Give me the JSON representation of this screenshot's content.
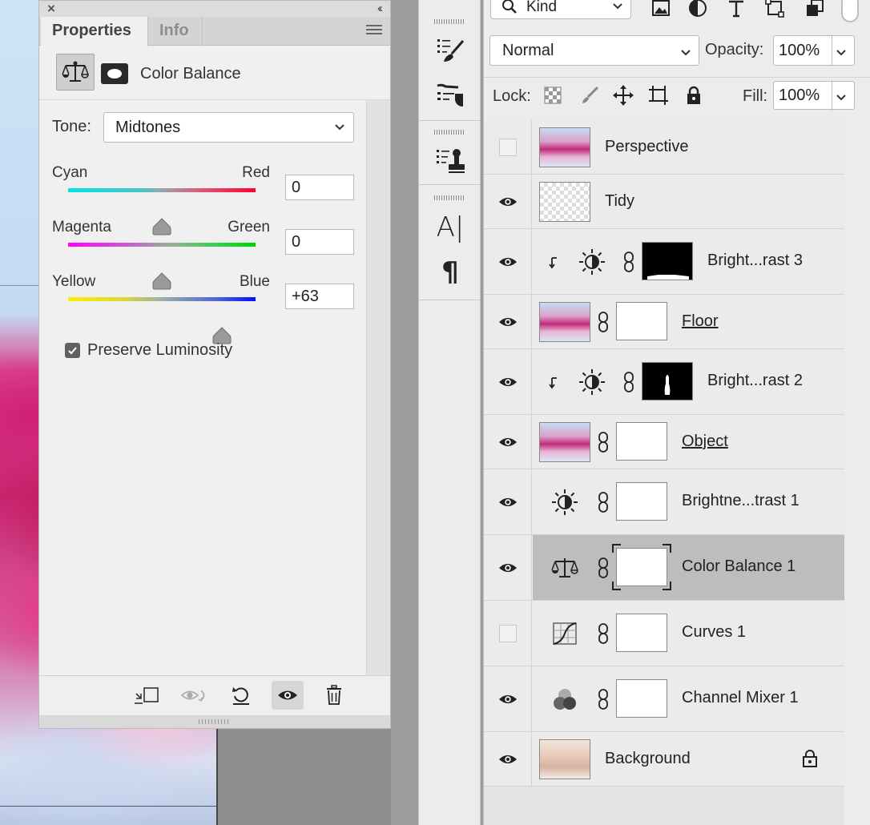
{
  "properties_panel": {
    "tabs": [
      {
        "label": "Properties",
        "active": true
      },
      {
        "label": "Info",
        "active": false
      }
    ],
    "adjustment_title": "Color Balance",
    "tone": {
      "label": "Tone:",
      "value": "Midtones"
    },
    "sliders": [
      {
        "left": "Cyan",
        "right": "Red",
        "value": "0",
        "position": 0.5
      },
      {
        "left": "Magenta",
        "right": "Green",
        "value": "0",
        "position": 0.5
      },
      {
        "left": "Yellow",
        "right": "Blue",
        "value": "+63",
        "position": 0.82
      }
    ],
    "preserve_luminosity": {
      "label": "Preserve Luminosity",
      "checked": true
    },
    "footer_icons": [
      "clip-to-layer-icon",
      "view-previous-state-icon",
      "reset-icon",
      "toggle-visibility-icon",
      "delete-icon"
    ]
  },
  "toolstrip": {
    "icons": [
      "brush-presets-icon",
      "tool-presets-icon",
      "clone-source-icon",
      "character-icon",
      "paragraph-icon"
    ],
    "character_glyph": "A|",
    "paragraph_glyph": "¶"
  },
  "layers_panel": {
    "filter": {
      "label": "Kind"
    },
    "blend_mode": "Normal",
    "opacity": {
      "label": "Opacity:",
      "value": "100%"
    },
    "lock": {
      "label": "Lock:"
    },
    "fill": {
      "label": "Fill:",
      "value": "100%"
    },
    "layers": [
      {
        "name": "Perspective",
        "visible": false,
        "kind": "pixel",
        "thumb": "photo"
      },
      {
        "name": "Tidy",
        "visible": true,
        "kind": "pixel",
        "thumb": "transparent"
      },
      {
        "name": "Bright...rast 3",
        "visible": true,
        "kind": "brightness",
        "clipped": true,
        "mask": "black-floor"
      },
      {
        "name": "Floor",
        "visible": true,
        "kind": "pixel-mask",
        "thumb": "photo",
        "underlined": true
      },
      {
        "name": "Bright...rast 2",
        "visible": true,
        "kind": "brightness",
        "clipped": true,
        "mask": "black-object"
      },
      {
        "name": "Object",
        "visible": true,
        "kind": "pixel-mask",
        "thumb": "photo",
        "underlined": true
      },
      {
        "name": "Brightne...trast 1",
        "visible": true,
        "kind": "brightness",
        "clipped": false,
        "mask": "white"
      },
      {
        "name": "Color Balance 1",
        "visible": true,
        "kind": "color-balance",
        "selected": true,
        "mask": "white"
      },
      {
        "name": "Curves 1",
        "visible": false,
        "kind": "curves",
        "mask": "white"
      },
      {
        "name": "Channel Mixer 1",
        "visible": true,
        "kind": "channel-mixer",
        "mask": "white"
      },
      {
        "name": "Background",
        "visible": true,
        "kind": "background",
        "thumb": "background",
        "locked": true
      }
    ]
  },
  "colors": {
    "panel_bg": "#f0f0f0",
    "selected_layer": "#bdbdbd",
    "canvas_magenta": "#c8246f"
  }
}
